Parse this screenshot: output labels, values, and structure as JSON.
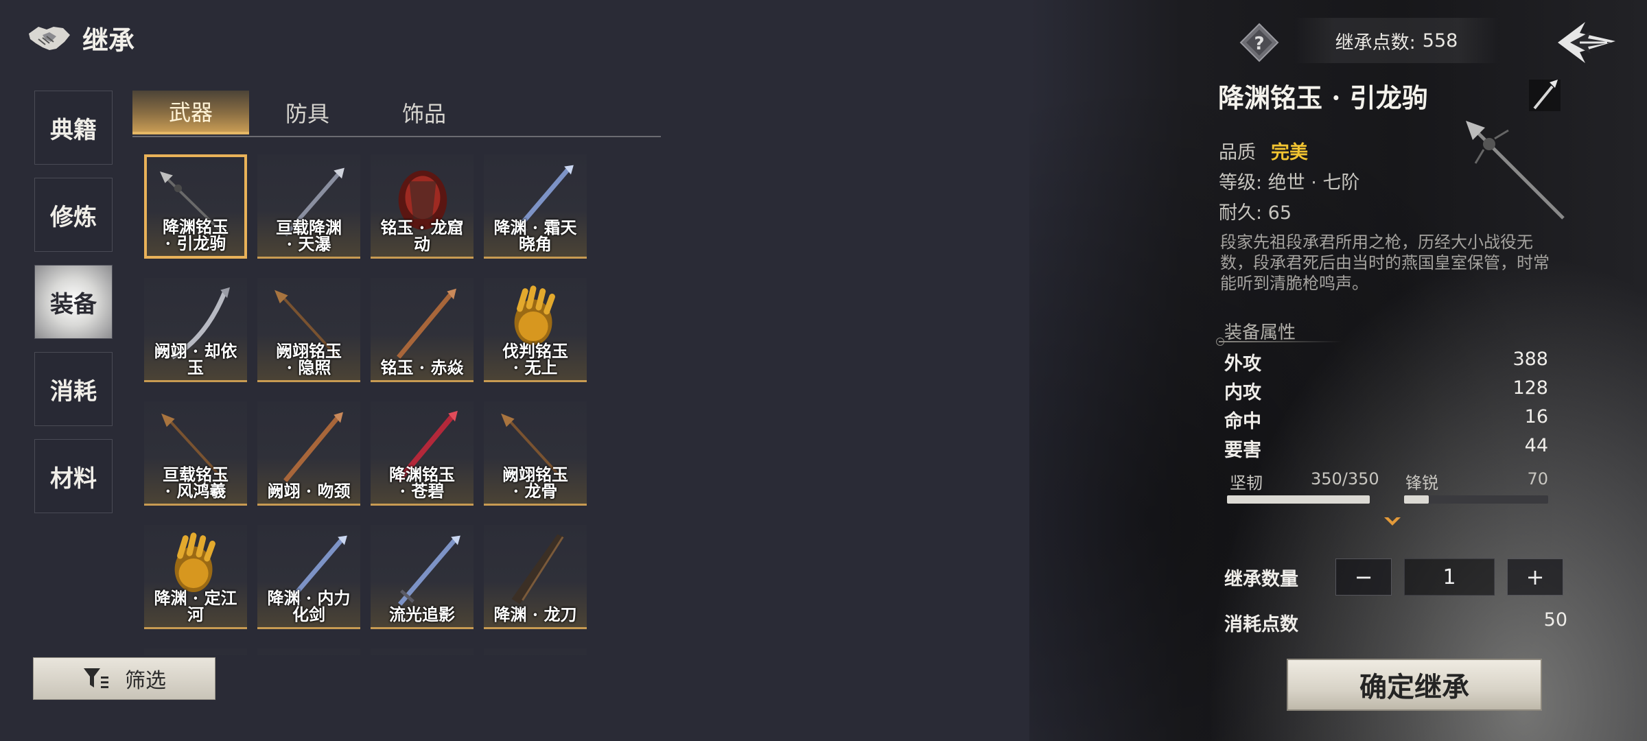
{
  "header": {
    "title": "继承"
  },
  "nav": {
    "items": [
      {
        "label": "典籍",
        "active": false
      },
      {
        "label": "修炼",
        "active": false
      },
      {
        "label": "装备",
        "active": true
      },
      {
        "label": "消耗",
        "active": false
      },
      {
        "label": "材料",
        "active": false
      }
    ]
  },
  "tabs": [
    {
      "label": "武器",
      "active": true
    },
    {
      "label": "防具",
      "active": false
    },
    {
      "label": "饰品",
      "active": false
    }
  ],
  "items": [
    {
      "line1": "降渊铭玉",
      "line2": "· 引龙驹",
      "icon": "spear-icon",
      "selected": true
    },
    {
      "line1": "亘载降渊",
      "line2": "· 天瀑",
      "icon": "sword-icon"
    },
    {
      "line1": "铭玉 · 龙窟",
      "line2": "动",
      "icon": "gauntlet-red-icon"
    },
    {
      "line1": "降渊 · 霜天",
      "line2": "晓角",
      "icon": "sword-blue-icon"
    },
    {
      "line1": "阙翊 · 却依",
      "line2": "玉",
      "icon": "curved-blade-icon"
    },
    {
      "line1": "阙翊铭玉",
      "line2": "· 隐照",
      "icon": "spear-bronze-icon"
    },
    {
      "line1": "铭玉 · 赤焱",
      "line2": "",
      "icon": "sword-bronze-icon"
    },
    {
      "line1": "伐判铭玉",
      "line2": "· 无上",
      "icon": "gauntlet-gold-icon"
    },
    {
      "line1": "亘载铭玉",
      "line2": "· 风鸿羲",
      "icon": "spear-bronze-icon"
    },
    {
      "line1": "阙翊 · 吻颈",
      "line2": "",
      "icon": "sword-bronze-icon"
    },
    {
      "line1": "降渊铭玉",
      "line2": "· 苍碧",
      "icon": "sword-red-icon"
    },
    {
      "line1": "阙翊铭玉",
      "line2": "· 龙骨",
      "icon": "spear-bronze-icon"
    },
    {
      "line1": "降渊 · 定江",
      "line2": "河",
      "icon": "gauntlet-gold-icon"
    },
    {
      "line1": "降渊 · 内力",
      "line2": "化剑",
      "icon": "sword-blue-icon"
    },
    {
      "line1": "流光追影",
      "line2": "",
      "icon": "sword-blue-icon"
    },
    {
      "line1": "降渊 · 龙刀",
      "line2": "",
      "icon": "broad-blade-icon"
    }
  ],
  "filter": {
    "label": "筛选"
  },
  "points": {
    "label": "继承点数:",
    "value": "558"
  },
  "detail": {
    "name": "降渊铭玉 · 引龙驹",
    "quality_label": "品质",
    "quality_value": "完美",
    "level": "等级:  绝世 · 七阶",
    "durability": "耐久: 65",
    "description": "段家先祖段承君所用之枪，历经大小战役无数，段承君死后由当时的燕国皇室保管，时常能听到清脆枪鸣声。",
    "section_title": "装备属性",
    "stats": [
      {
        "label": "外攻",
        "value": "388"
      },
      {
        "label": "内攻",
        "value": "128"
      },
      {
        "label": "命中",
        "value": "16"
      },
      {
        "label": "要害",
        "value": "44"
      }
    ],
    "bars": [
      {
        "label": "坚韧",
        "value": "350/350",
        "fraction": 1.0
      },
      {
        "label": "锋锐",
        "value": "70",
        "fraction": 0.17
      }
    ]
  },
  "inherit": {
    "qty_label": "继承数量",
    "minus": "−",
    "plus": "+",
    "qty": "1",
    "cost_label": "消耗点数",
    "cost_value": "50",
    "confirm": "确定继承"
  },
  "colors": {
    "accent_gold": "#e9b259",
    "quality": "#f2c431"
  }
}
